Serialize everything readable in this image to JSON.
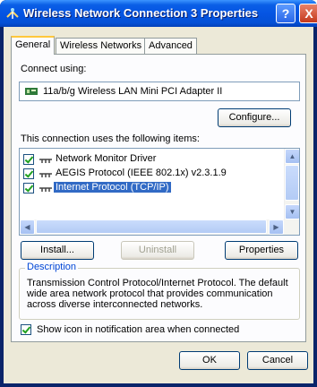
{
  "window": {
    "title": "Wireless Network Connection 3 Properties",
    "help_label": "?",
    "close_label": "X"
  },
  "tabs": [
    {
      "label": "General",
      "active": true
    },
    {
      "label": "Wireless Networks",
      "active": false
    },
    {
      "label": "Advanced",
      "active": false
    }
  ],
  "general": {
    "connect_using_label": "Connect using:",
    "adapter_name": "11a/b/g Wireless LAN Mini PCI Adapter II",
    "configure_label": "Configure...",
    "items_label": "This connection uses the following items:",
    "items": [
      {
        "label": "Network Monitor Driver",
        "checked": true,
        "selected": false
      },
      {
        "label": "AEGIS Protocol (IEEE 802.1x) v2.3.1.9",
        "checked": true,
        "selected": false
      },
      {
        "label": "Internet Protocol (TCP/IP)",
        "checked": true,
        "selected": true
      }
    ],
    "install_label": "Install...",
    "uninstall_label": "Uninstall",
    "properties_label": "Properties",
    "description_title": "Description",
    "description_text": "Transmission Control Protocol/Internet Protocol. The default wide area network protocol that provides communication across diverse interconnected networks.",
    "show_icon_label": "Show icon in notification area when connected",
    "show_icon_checked": true
  },
  "footer": {
    "ok_label": "OK",
    "cancel_label": "Cancel"
  },
  "colors": {
    "titlebar": "#0554e3",
    "dialog_bg": "#ece9d8",
    "selection": "#316ac5",
    "group_title": "#0046d5"
  }
}
